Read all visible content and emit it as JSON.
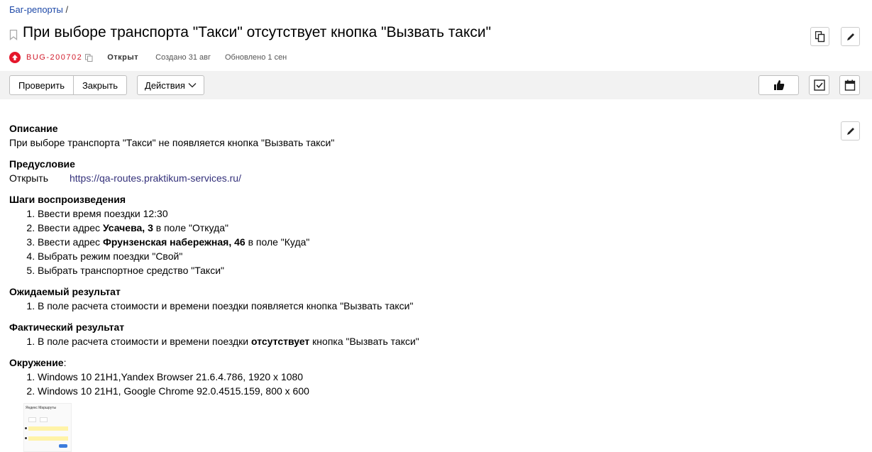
{
  "breadcrumb": {
    "link": "Баг-репорты",
    "separator": "/"
  },
  "issue": {
    "title": "При выборе транспорта \"Такси\" отсутствует кнопка \"Вызвать такси\"",
    "key": "BUG-200702",
    "status": "Открыт",
    "created": "Создано 31 авг",
    "updated": "Обновлено 1 сен"
  },
  "toolbar": {
    "check_label": "Проверить",
    "close_label": "Закрыть",
    "actions_label": "Действия"
  },
  "description": {
    "heading": "Описание",
    "text": "При выборе транспорта \"Такси\" не появляется кнопка \"Вызвать такси\""
  },
  "precondition": {
    "heading": "Предусловие",
    "action": "Открыть",
    "url": "https://qa-routes.praktikum-services.ru/"
  },
  "steps": {
    "heading": "Шаги воспроизведения",
    "items": [
      {
        "before": "Ввести время поездки 12:30",
        "bold": "",
        "after": ""
      },
      {
        "before": "Ввести адрес ",
        "bold": "Усачева, 3",
        "after": " в поле \"Откуда\""
      },
      {
        "before": "Ввести адрес ",
        "bold": "Фрунзенская набережная, 46",
        "after": " в поле \"Куда\""
      },
      {
        "before": "Выбрать режим поездки \"Свой\"",
        "bold": "",
        "after": ""
      },
      {
        "before": "Выбрать транспортное средство \"Такси\"",
        "bold": "",
        "after": ""
      }
    ]
  },
  "expected": {
    "heading": "Ожидаемый результат",
    "items": [
      {
        "before": "В поле расчета стоимости и времени поездки появляется кнопка \"Вызвать такси\"",
        "bold": "",
        "after": ""
      }
    ]
  },
  "actual": {
    "heading": "Фактический результат",
    "items": [
      {
        "before": "В поле расчета стоимости и времени поездки ",
        "bold": "отсутствует",
        "after": " кнопка \"Вызвать такси\""
      }
    ]
  },
  "environment": {
    "heading": "Окружение",
    "suffix": ":",
    "items": [
      {
        "before": "Windows 10 21H1,Yandex Browser 21.6.4.786, 1920 x 1080",
        "bold": "",
        "after": ""
      },
      {
        "before": "Windows 10 21H1, Google Chrome 92.0.4515.159, 800 x 600",
        "bold": "",
        "after": ""
      }
    ]
  },
  "attachment": {
    "logo_text": "Яндекс Маршруты"
  },
  "colors": {
    "link": "#1f4aa8",
    "priority": "#e5162b",
    "key": "#d11a2a",
    "toolbar_bg": "#f2f2f2"
  },
  "icons": [
    "bookmark-icon",
    "copy-icon",
    "edit-icon",
    "priority-up-icon",
    "clone-icon",
    "thumbs-up-icon",
    "checklist-icon",
    "calendar-icon",
    "chevron-down-icon"
  ]
}
